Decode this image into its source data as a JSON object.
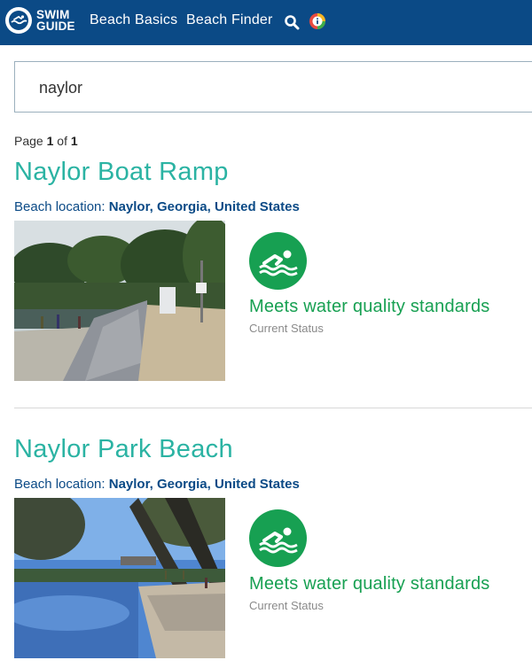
{
  "header": {
    "logo_line1": "SWIM",
    "logo_line2": "GUIDE",
    "nav": [
      "Beach Basics",
      "Beach Finder"
    ],
    "brand_color": "#0b4a86"
  },
  "search": {
    "value": "naylor"
  },
  "pagination": {
    "label": "Page",
    "current": "1",
    "of": "of",
    "total": "1"
  },
  "results": [
    {
      "title": "Naylor Boat Ramp",
      "location_label": "Beach location:",
      "location": "Naylor, Georgia, United States",
      "status": "Meets water quality standards",
      "status_sub": "Current Status",
      "status_color": "#17a052",
      "photo_icon": "boat-ramp-photo"
    },
    {
      "title": "Naylor Park Beach",
      "location_label": "Beach location:",
      "location": "Naylor, Georgia, United States",
      "status": "Meets water quality standards",
      "status_sub": "Current Status",
      "status_color": "#17a052",
      "photo_icon": "park-beach-photo"
    }
  ],
  "colors": {
    "title": "#2bb3a3",
    "location": "#0b4a86",
    "status_green": "#17a052"
  }
}
